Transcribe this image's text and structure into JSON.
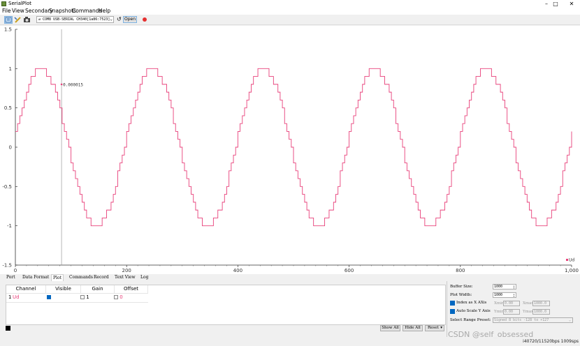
{
  "window": {
    "title": "SerialPlot",
    "controls": [
      "–",
      "□",
      "✕"
    ]
  },
  "menu": [
    "File",
    "View",
    "Secondary",
    "Snapshots",
    "Commands",
    "Help"
  ],
  "toolbar": {
    "port": "COM8 USB-SERIAL CH340[1a86:7523]",
    "open_label": "Open",
    "icons": [
      "plot-view-icon",
      "pencil-icon",
      "camera-icon",
      "refresh-icon",
      "record-icon"
    ]
  },
  "plot": {
    "marker_label": "0.000015",
    "legend": "Ud",
    "line_color": "#e8407a",
    "y_ticks": [
      "1.5",
      "1",
      "0.5",
      "0",
      "-0.5",
      "-1",
      "-1.5"
    ],
    "x_ticks": [
      "0",
      "200",
      "400",
      "600",
      "800",
      "1,000"
    ]
  },
  "chart_data": {
    "type": "line",
    "title": "",
    "xlabel": "",
    "ylabel": "",
    "xlim": [
      0,
      1000
    ],
    "ylim": [
      -1.5,
      1.5
    ],
    "grid": false,
    "legend_placement": "bottom-right",
    "series": [
      {
        "name": "Ud",
        "description_period": 200,
        "x_start": 0,
        "x_step": 4,
        "values_step": 0.1
      }
    ],
    "marker": {
      "x": 83,
      "y": 1.5e-05
    }
  },
  "tabs": [
    "Port",
    "Data Format",
    "Plot",
    "Commands",
    "Record",
    "Text View",
    "Log"
  ],
  "selected_tab": "Plot",
  "channels": {
    "headers": [
      "Channel",
      "Visible",
      "Gain",
      "Offset"
    ],
    "rows": [
      {
        "index": "1",
        "name": "Ud",
        "visible": true,
        "gain": "1",
        "offset": "0"
      }
    ]
  },
  "buttons": {
    "show_all": "Show All",
    "hide_all": "Hide All",
    "reset": "Reset"
  },
  "settings": {
    "buffer_size_label": "Buffer Size:",
    "buffer_size": "1000",
    "plot_width_label": "Plot Width:",
    "plot_width": "1000",
    "index_as_x_label": "Index as X AXis",
    "auto_scale_label": "Auto Scale Y Axis",
    "xmin_label": "Xmin",
    "xmin": "0.00",
    "xmax_label": "Xmax",
    "xmax": "1000.0",
    "ymin_label": "Ymin",
    "ymin": "0.00",
    "ymax_label": "Ymax",
    "ymax": "1000.0",
    "range_preset_label": "Select Range Preset:",
    "range_preset": "Signed 8 bits -128 to +127"
  },
  "status": "i40720/11520bps 1009sps",
  "watermark": "CSDN @self_obsessed"
}
